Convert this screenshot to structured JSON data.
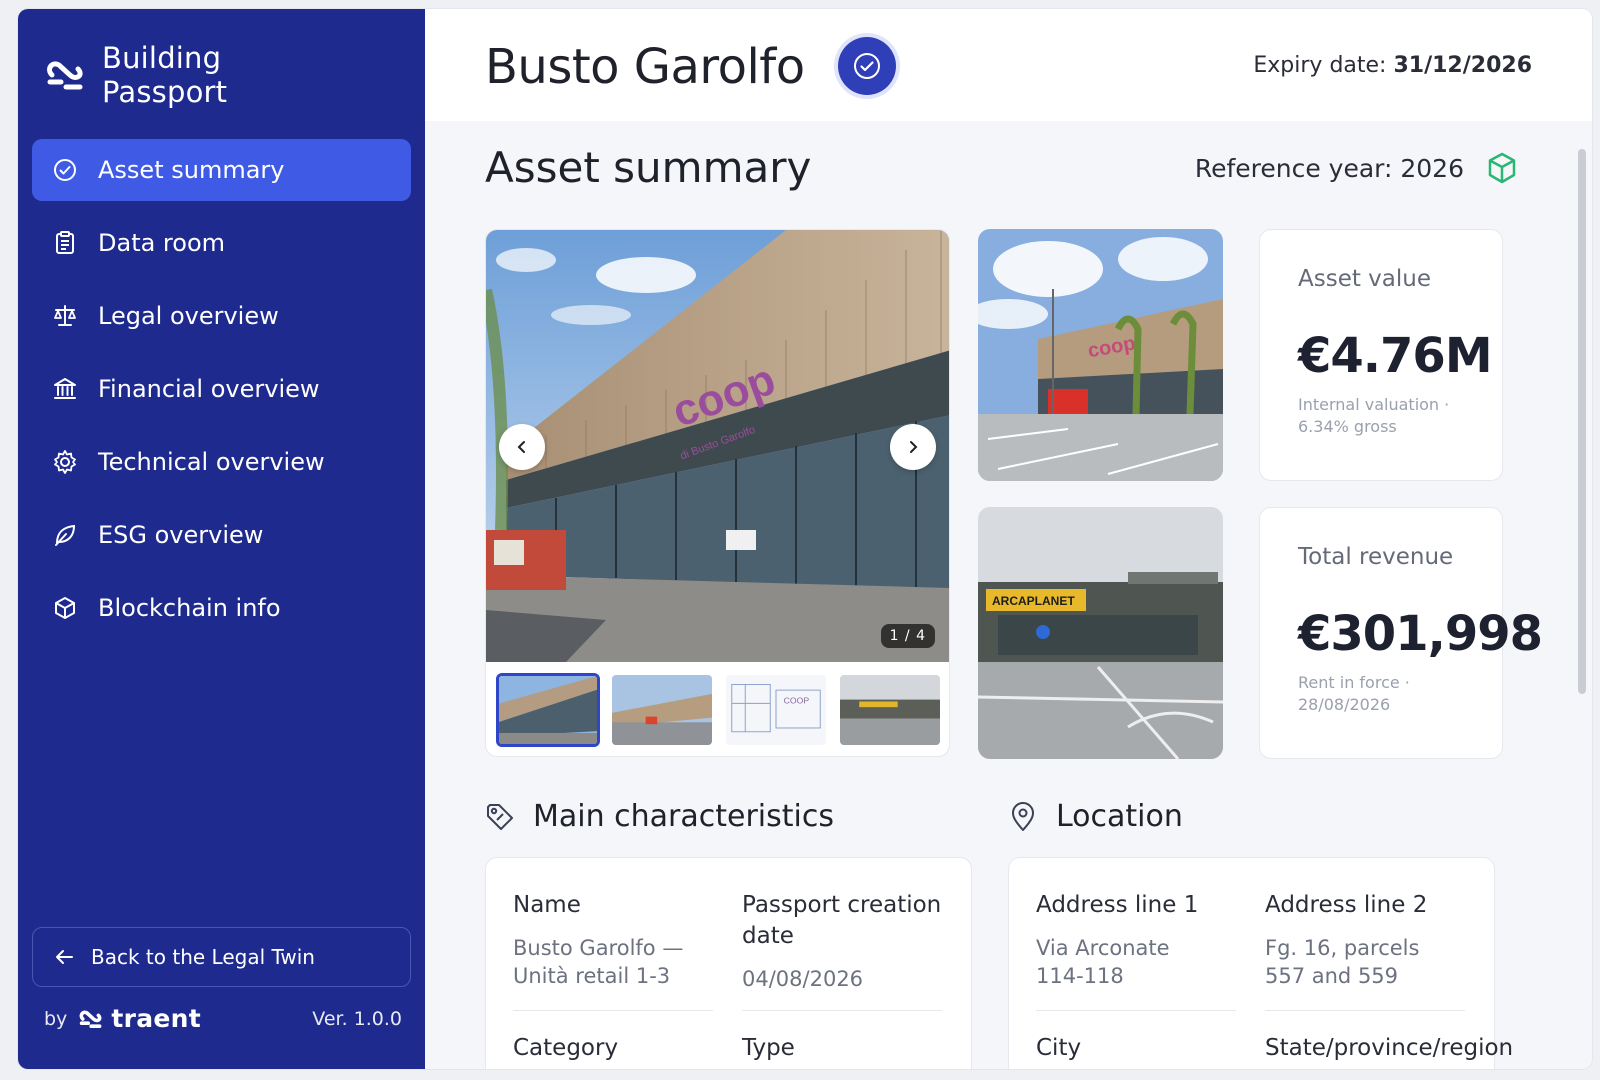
{
  "brand": {
    "line1": "Building",
    "line2": "Passport"
  },
  "nav": {
    "items": [
      {
        "label": "Asset summary",
        "icon": "check-circle-icon"
      },
      {
        "label": "Data room",
        "icon": "clipboard-icon"
      },
      {
        "label": "Legal overview",
        "icon": "scale-icon"
      },
      {
        "label": "Financial overview",
        "icon": "bank-icon"
      },
      {
        "label": "Technical overview",
        "icon": "gear-icon"
      },
      {
        "label": "ESG overview",
        "icon": "leaf-icon"
      },
      {
        "label": "Blockchain info",
        "icon": "cube-icon"
      }
    ],
    "active_index": 0
  },
  "back": {
    "label": "Back to the Legal Twin"
  },
  "footer": {
    "by": "by",
    "company": "traent",
    "version": "Ver. 1.0.0"
  },
  "header": {
    "title": "Busto Garolfo",
    "expiry_label": "Expiry date:",
    "expiry_value": "31/12/2026"
  },
  "main": {
    "section_title": "Asset summary",
    "reference_year": "Reference year: 2026",
    "gallery": {
      "counter": "1 / 4",
      "thumbnail_sign_text": "COOP",
      "storefront_sign": "coop",
      "storefront_subsign": "di Busto Garolfo"
    },
    "photo2_sign": "ARCAPLANET",
    "stats": [
      {
        "label": "Asset value",
        "value": "€4.76M",
        "note": "Internal valuation · 6.34% gross"
      },
      {
        "label": "Total revenue",
        "value": "€301,998",
        "note": "Rent in force · 28/08/2026"
      }
    ],
    "characteristics": {
      "title": "Main characteristics",
      "fields": [
        {
          "label": "Name",
          "value": "Busto Garolfo — Unità retail 1-3"
        },
        {
          "label": "Passport creation date",
          "value": "04/08/2026"
        },
        {
          "label": "Category",
          "value": ""
        },
        {
          "label": "Type",
          "value": ""
        }
      ]
    },
    "location": {
      "title": "Location",
      "fields": [
        {
          "label": "Address line 1",
          "value": "Via Arconate 114-118"
        },
        {
          "label": "Address line 2",
          "value": "Fg. 16, parcels 557 and 559"
        },
        {
          "label": "City",
          "value": ""
        },
        {
          "label": "State/province/region",
          "value": ""
        }
      ]
    }
  },
  "colors": {
    "sidebar": "#1e2a8e",
    "active": "#3f5be6",
    "accent": "#2f3fb7",
    "cube": "#2bb673"
  }
}
